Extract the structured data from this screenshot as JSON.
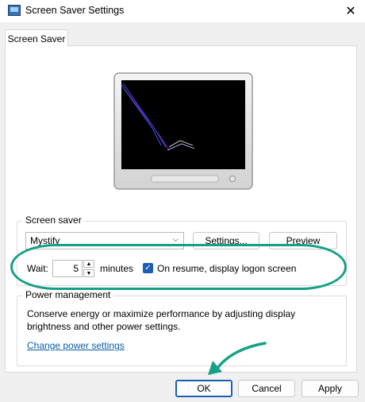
{
  "window": {
    "title": "Screen Saver Settings",
    "close_glyph": "✕"
  },
  "tabs": [
    {
      "label": "Screen Saver"
    }
  ],
  "screen_saver": {
    "group_label": "Screen saver",
    "selected": "Mystify",
    "settings_label": "Settings...",
    "preview_label": "Preview",
    "wait_label": "Wait:",
    "wait_value": "5",
    "minutes_label": "minutes",
    "resume_checked": true,
    "resume_label": "On resume, display logon screen"
  },
  "power": {
    "group_label": "Power management",
    "description_line1": "Conserve energy or maximize performance by adjusting display",
    "description_line2": "brightness and other power settings.",
    "link_label": "Change power settings"
  },
  "buttons": {
    "ok": "OK",
    "cancel": "Cancel",
    "apply": "Apply"
  },
  "colors": {
    "highlight": "#16a085",
    "accent": "#1a5fb4",
    "link": "#0b5ea8"
  },
  "icons": {
    "app": "screen-saver-app-icon",
    "close": "close-icon",
    "combo": "chevron-down-icon",
    "spin_up": "spin-up-icon",
    "spin_down": "spin-down-icon",
    "checkbox": "checkmark-icon"
  }
}
